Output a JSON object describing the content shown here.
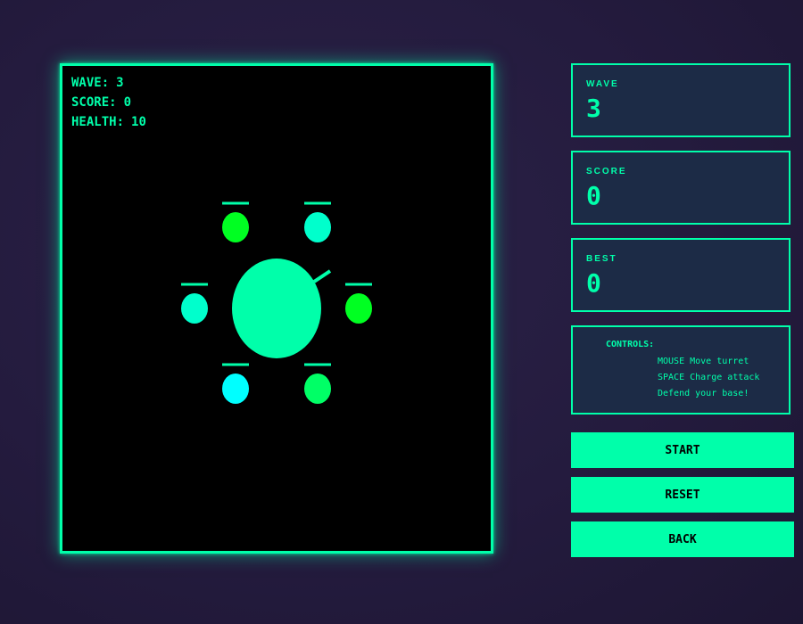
{
  "hud": {
    "wave_label": "WAVE:",
    "wave_value": "3",
    "score_label": "SCORE:",
    "score_value": "0",
    "health_label": "HEALTH:",
    "health_value": "10"
  },
  "stats": {
    "wave": {
      "label": "WAVE",
      "value": "3"
    },
    "score": {
      "label": "SCORE",
      "value": "0"
    },
    "best": {
      "label": "BEST",
      "value": "0"
    }
  },
  "controls": {
    "title": "CONTROLS:",
    "lines": [
      "MOUSE Move turret",
      "SPACE Charge attack",
      "Defend your base!"
    ]
  },
  "buttons": {
    "start": "START",
    "reset": "RESET",
    "back": "BACK"
  },
  "colors": {
    "accent": "#00ffaa",
    "enemy_green": "#00ff22",
    "enemy_teal": "#00ffcc",
    "enemy_cyan": "#00ffff",
    "enemy_mint": "#00ff66"
  },
  "game": {
    "enemies": [
      {
        "color": "#00ff22"
      },
      {
        "color": "#00ffcc"
      },
      {
        "color": "#00ffcc"
      },
      {
        "color": "#00ff22"
      },
      {
        "color": "#00ffff"
      },
      {
        "color": "#00ff66"
      }
    ]
  }
}
